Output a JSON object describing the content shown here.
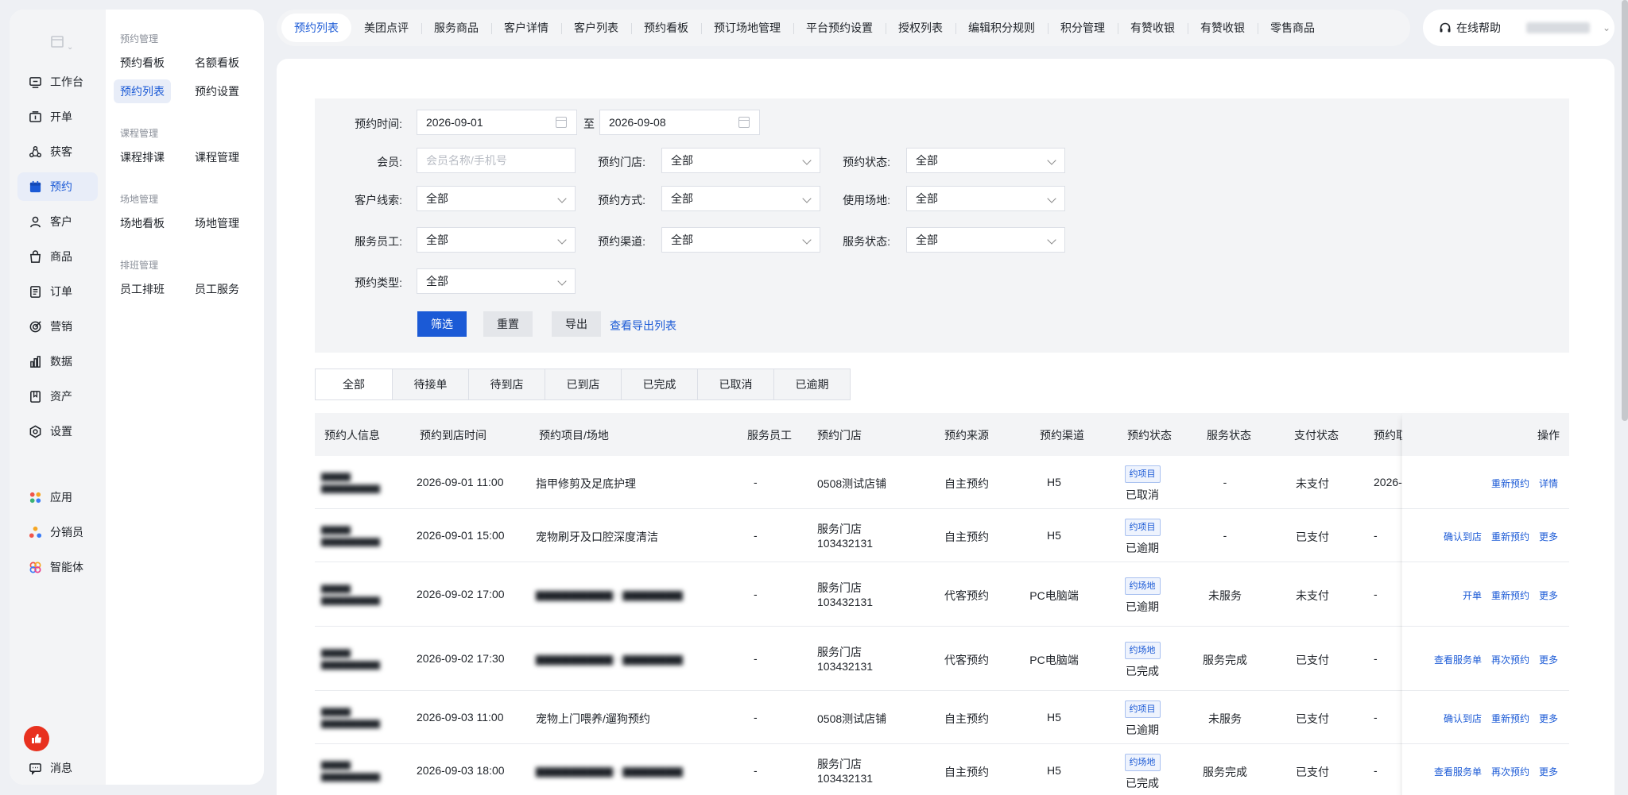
{
  "nav": {
    "items": [
      {
        "key": "workbench",
        "icon": "workbench-icon",
        "label": "工作台"
      },
      {
        "key": "billing",
        "icon": "register-icon",
        "label": "开单"
      },
      {
        "key": "acquire",
        "icon": "acquire-icon",
        "label": "获客"
      },
      {
        "key": "booking",
        "icon": "calendar-icon",
        "label": "预约",
        "active": true
      },
      {
        "key": "customer",
        "icon": "user-icon",
        "label": "客户"
      },
      {
        "key": "product",
        "icon": "bag-icon",
        "label": "商品"
      },
      {
        "key": "order",
        "icon": "document-icon",
        "label": "订单"
      },
      {
        "key": "marketing",
        "icon": "target-icon",
        "label": "营销"
      },
      {
        "key": "data",
        "icon": "bar-chart-icon",
        "label": "数据"
      },
      {
        "key": "assets",
        "icon": "bookmark-icon",
        "label": "资产"
      },
      {
        "key": "settings",
        "icon": "gear-icon",
        "label": "设置"
      },
      {
        "key": "apps",
        "icon": "apps-icon",
        "label": "应用"
      },
      {
        "key": "distributor",
        "icon": "distributor-icon",
        "label": "分销员"
      },
      {
        "key": "agent",
        "icon": "agent-icon",
        "label": "智能体"
      }
    ],
    "message_label": "消息"
  },
  "submenu": {
    "groups": [
      {
        "title": "预约管理",
        "items": [
          "预约看板",
          "名额看板",
          "预约列表",
          "预约设置"
        ]
      },
      {
        "title": "课程管理",
        "items": [
          "课程排课",
          "课程管理"
        ]
      },
      {
        "title": "场地管理",
        "items": [
          "场地看板",
          "场地管理"
        ]
      },
      {
        "title": "排班管理",
        "items": [
          "员工排班",
          "员工服务"
        ]
      }
    ],
    "active": "预约列表"
  },
  "tabs": [
    "预约列表",
    "美团点评",
    "服务商品",
    "客户详情",
    "客户列表",
    "预约看板",
    "预订场地管理",
    "平台预约设置",
    "授权列表",
    "编辑积分规则",
    "积分管理",
    "有赞收银",
    "有赞收银",
    "零售商品"
  ],
  "help_label": "在线帮助",
  "filter": {
    "time_label": "预约时间:",
    "date_from": "2026-09-01",
    "date_sep": "至",
    "date_to": "2026-09-08",
    "member_label": "会员:",
    "member_placeholder": "会员名称/手机号",
    "store_label": "预约门店:",
    "store_value": "全部",
    "status_label": "预约状态:",
    "status_value": "全部",
    "lead_label": "客户线索:",
    "lead_value": "全部",
    "method_label": "预约方式:",
    "method_value": "全部",
    "venue_label": "使用场地:",
    "venue_value": "全部",
    "staff_label": "服务员工:",
    "staff_value": "全部",
    "channel_label": "预约渠道:",
    "channel_value": "全部",
    "service_label": "服务状态:",
    "service_value": "全部",
    "type_label": "预约类型:",
    "type_value": "全部",
    "btn_filter": "筛选",
    "btn_reset": "重置",
    "btn_export": "导出",
    "link_export_list": "查看导出列表"
  },
  "status_tabs": [
    "全部",
    "待接单",
    "待到店",
    "已到店",
    "已完成",
    "已取消",
    "已逾期"
  ],
  "columns": [
    "预约人信息",
    "预约到店时间",
    "预约项目/场地",
    "服务员工",
    "预约门店",
    "预约来源",
    "预约渠道",
    "预约状态",
    "服务状态",
    "支付状态",
    "预约取",
    "操作"
  ],
  "rows": [
    {
      "time": "2026-09-01 11:00",
      "item": "指甲修剪及足底护理",
      "staff": "-",
      "store": "0508测试店铺",
      "store2": "",
      "source": "自主预约",
      "channel": "H5",
      "badge": "约项目",
      "status": "已取消",
      "service": "-",
      "pay": "未支付",
      "extra": "2026-",
      "ops": [
        "重新预约",
        "详情"
      ]
    },
    {
      "time": "2026-09-01 15:00",
      "item": "宠物刷牙及口腔深度清洁",
      "staff": "-",
      "store": "服务门店",
      "store2": "103432131",
      "source": "自主预约",
      "channel": "H5",
      "badge": "约项目",
      "status": "已逾期",
      "service": "-",
      "pay": "已支付",
      "extra": "-",
      "ops": [
        "确认到店",
        "重新预约",
        "更多"
      ]
    },
    {
      "time": "2026-09-02 17:00",
      "item": "",
      "staff": "-",
      "store": "服务门店",
      "store2": "103432131",
      "source": "代客预约",
      "channel": "PC电脑端",
      "badge": "约场地",
      "status": "已逾期",
      "service": "未服务",
      "pay": "未支付",
      "extra": "-",
      "ops": [
        "开单",
        "重新预约",
        "更多"
      ]
    },
    {
      "time": "2026-09-02 17:30",
      "item": "",
      "staff": "-",
      "store": "服务门店",
      "store2": "103432131",
      "source": "代客预约",
      "channel": "PC电脑端",
      "badge": "约场地",
      "status": "已完成",
      "service": "服务完成",
      "pay": "已支付",
      "extra": "-",
      "ops": [
        "查看服务单",
        "再次预约",
        "更多"
      ]
    },
    {
      "time": "2026-09-03 11:00",
      "item": "宠物上门喂养/遛狗预约",
      "staff": "-",
      "store": "0508测试店铺",
      "store2": "",
      "source": "自主预约",
      "channel": "H5",
      "badge": "约项目",
      "status": "已逾期",
      "service": "未服务",
      "pay": "已支付",
      "extra": "-",
      "ops": [
        "确认到店",
        "重新预约",
        "更多"
      ]
    },
    {
      "time": "2026-09-03 18:00",
      "item": "",
      "staff": "-",
      "store": "服务门店",
      "store2": "103432131",
      "source": "自主预约",
      "channel": "H5",
      "badge": "约场地",
      "status": "已完成",
      "service": "服务完成",
      "pay": "已支付",
      "extra": "-",
      "ops": [
        "查看服务单",
        "再次预约",
        "更多"
      ]
    }
  ]
}
